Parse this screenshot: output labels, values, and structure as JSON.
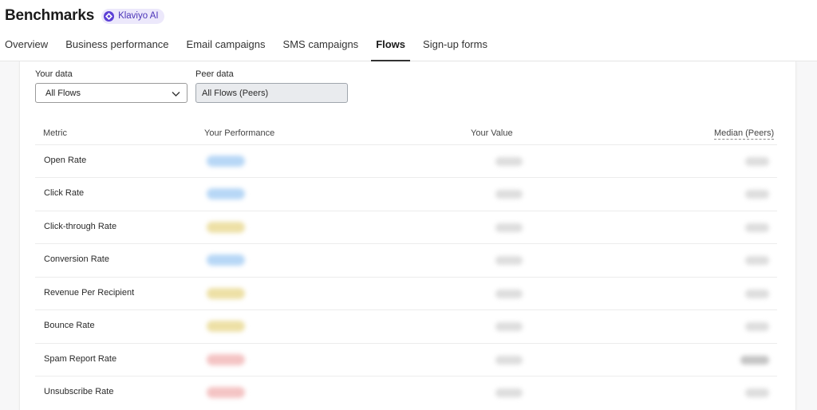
{
  "header": {
    "title": "Benchmarks",
    "badge_label": "Klaviyo AI",
    "tabs": [
      {
        "label": "Overview",
        "active": false
      },
      {
        "label": "Business performance",
        "active": false
      },
      {
        "label": "Email campaigns",
        "active": false
      },
      {
        "label": "SMS campaigns",
        "active": false
      },
      {
        "label": "Flows",
        "active": true
      },
      {
        "label": "Sign-up forms",
        "active": false
      }
    ]
  },
  "filters": {
    "your_data_label": "Your data",
    "your_data_value": "All Flows",
    "peer_data_label": "Peer data",
    "peer_data_value": "All Flows (Peers)"
  },
  "table": {
    "columns": [
      "Metric",
      "Your Performance",
      "Your Value",
      "Median (Peers)"
    ],
    "rows": [
      {
        "metric": "Open Rate",
        "performance_color": "blue"
      },
      {
        "metric": "Click Rate",
        "performance_color": "blue"
      },
      {
        "metric": "Click-through Rate",
        "performance_color": "yellow"
      },
      {
        "metric": "Conversion Rate",
        "performance_color": "blue"
      },
      {
        "metric": "Revenue Per Recipient",
        "performance_color": "yellow"
      },
      {
        "metric": "Bounce Rate",
        "performance_color": "yellow"
      },
      {
        "metric": "Spam Report Rate",
        "performance_color": "red"
      },
      {
        "metric": "Unsubscribe Rate",
        "performance_color": "red"
      }
    ]
  },
  "colors": {
    "accent": "#5b3fd6",
    "badge_bg": "#ece8fb",
    "good": "#b7d7f6",
    "average": "#ede0a6",
    "poor": "#f4c4c4"
  }
}
